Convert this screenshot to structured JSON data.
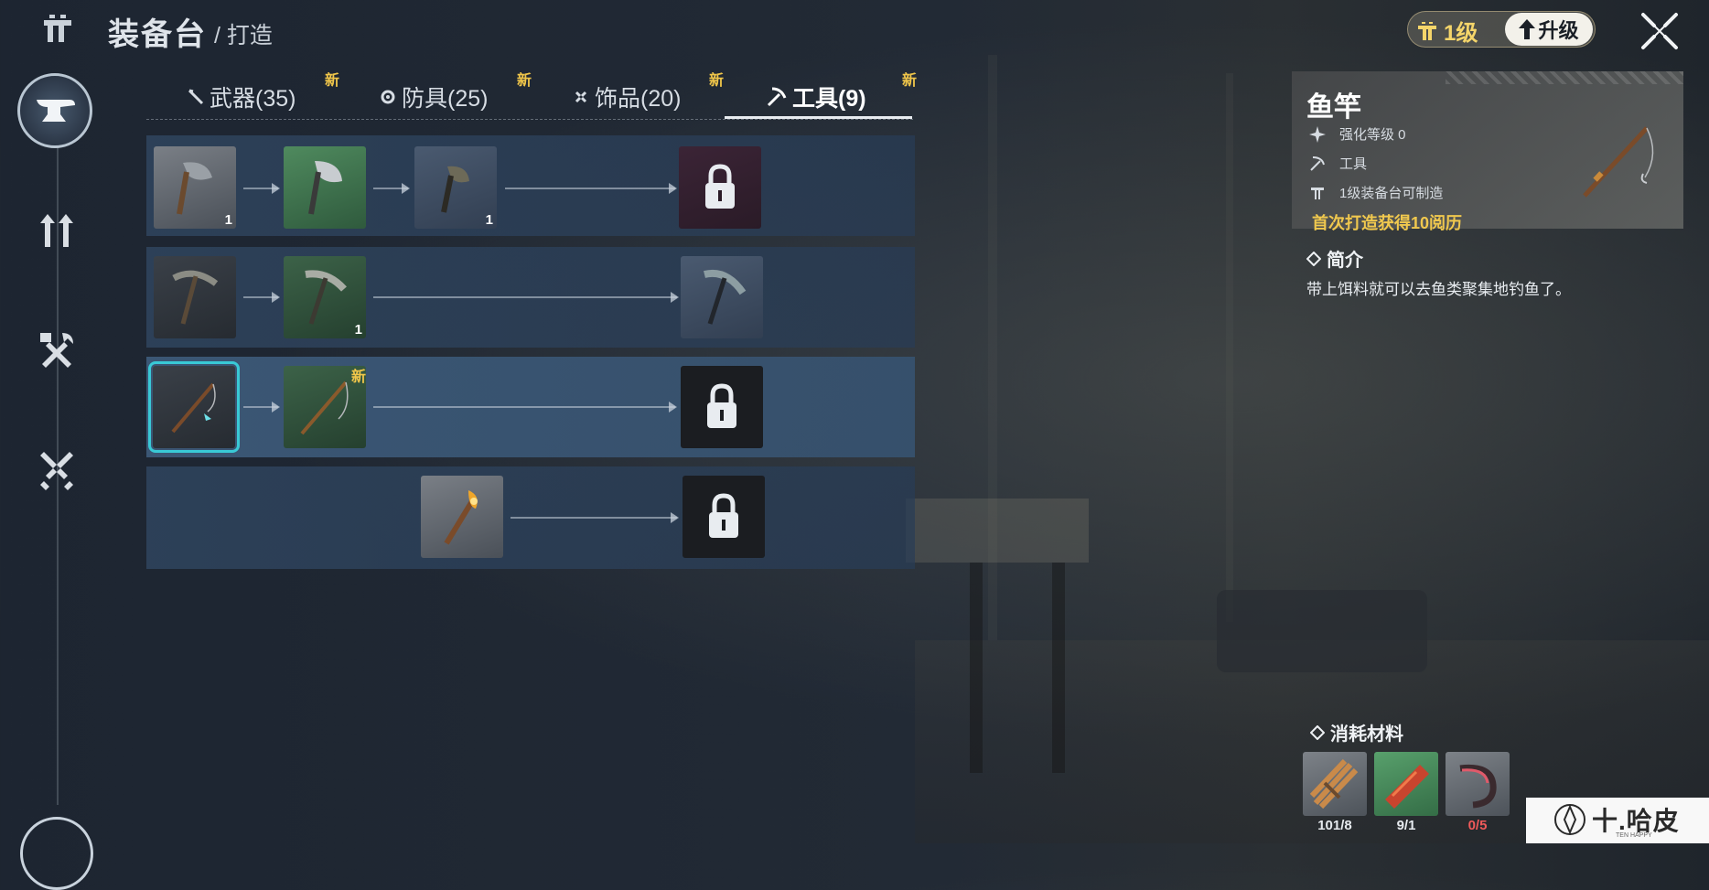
{
  "header": {
    "title": "装备台",
    "breadcrumb": "/ 打造",
    "level_label": "1级",
    "upgrade_label": "升级"
  },
  "tabs": [
    {
      "label": "武器(35)",
      "badge": "新",
      "icon": "sword-icon"
    },
    {
      "label": "防具(25)",
      "badge": "新",
      "icon": "shield-ring-icon"
    },
    {
      "label": "饰品(20)",
      "badge": "新",
      "icon": "ornament-icon"
    },
    {
      "label": "工具(9)",
      "badge": "新",
      "icon": "pickaxe-icon",
      "active": true
    }
  ],
  "tree": {
    "rows": [
      {
        "items": [
          {
            "icon": "axe-tier1-icon",
            "count": "1"
          },
          {
            "icon": "axe-tier2-icon",
            "count": ""
          },
          {
            "icon": "axe-tier3-icon",
            "count": "1"
          },
          {
            "icon": "lock-icon",
            "count": ""
          }
        ]
      },
      {
        "items": [
          {
            "icon": "pickaxe-tier1-icon",
            "count": ""
          },
          {
            "icon": "pickaxe-tier2-icon",
            "count": "1"
          },
          {
            "icon": "pickaxe-tier3-icon",
            "count": ""
          }
        ]
      },
      {
        "items": [
          {
            "icon": "fishing-rod-icon",
            "count": ""
          },
          {
            "icon": "fishing-rod-tier2-icon",
            "count": "",
            "badge": "新"
          },
          {
            "icon": "lock-icon",
            "count": ""
          }
        ]
      },
      {
        "items": [
          {
            "icon": "torch-icon",
            "count": ""
          },
          {
            "icon": "lock-icon",
            "count": ""
          }
        ]
      }
    ]
  },
  "detail": {
    "name": "鱼竿",
    "props": [
      {
        "icon": "sparkle-icon",
        "text": "强化等级 0"
      },
      {
        "icon": "pickaxe-icon",
        "text": "工具"
      },
      {
        "icon": "workbench-icon",
        "text": "1级装备台可制造"
      }
    ],
    "first_bonus": "首次打造获得10阅历",
    "intro_title": "简介",
    "intro_text": "带上饵料就可以去鱼类聚集地钓鱼了。",
    "materials_title": "消耗材料",
    "materials": [
      {
        "icon": "wood-bundle-icon",
        "count": "101/8",
        "enough": true
      },
      {
        "icon": "red-material-icon",
        "count": "9/1",
        "enough": true
      },
      {
        "icon": "hook-material-icon",
        "count": "0/5",
        "enough": false
      }
    ]
  },
  "watermark": {
    "text": "十.哈皮",
    "sub": "TEN HAPPY"
  },
  "colors": {
    "accent_gold": "#f0c84e",
    "selected_outline": "#39c9d6",
    "insufficient": "#ef5a5a"
  }
}
